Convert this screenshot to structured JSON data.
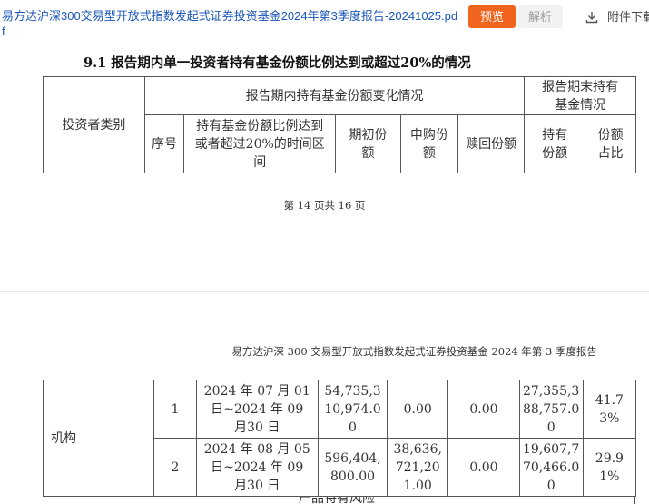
{
  "topbar": {
    "filename": "易方达沪深300交易型开放式指数发起式证券投资基金2024年第3季度报告-20241025.pdf",
    "preview_label": "预览",
    "parse_label": "解析",
    "attachment_label": "附件下载"
  },
  "page1": {
    "section_title": "9.1 报告期内单一投资者持有基金份额比例达到或超过20%的情况",
    "table_headers": {
      "investor_type": "投资者类别",
      "change_group": "报告期内持有基金份额变化情况",
      "end_group": "报告期末持有基金情况",
      "seq": "序号",
      "interval": "持有基金份额比例达到或者超过20%的时间区间",
      "opening": "期初份额",
      "subscribe": "申购份额",
      "redeem": "赎回份额",
      "holding": "持有份额",
      "ratio": "份额占比"
    },
    "footer": "第 14 页共 16 页"
  },
  "page2": {
    "running_header": "易方达沪深 300 交易型开放式指数发起式证券投资基金 2024 年第 3 季度报告",
    "institution_label": "机构",
    "rows": [
      {
        "seq": "1",
        "interval": "2024 年 07 月 01日~2024 年 09 月30 日",
        "opening": "54,735,310,974.00",
        "subscribe": "0.00",
        "redeem": "0.00",
        "holding": "27,355,388,757.00",
        "ratio": "41.73%"
      },
      {
        "seq": "2",
        "interval": "2024 年 08 月 05日~2024 年 09 月30 日",
        "opening": "596,404,800.00",
        "subscribe": "38,636,721,201.00",
        "redeem": "0.00",
        "holding": "19,607,770,466.00",
        "ratio": "29.91%"
      }
    ],
    "cutoff_text": "产品特有风险"
  },
  "colors": {
    "link": "#1a56b8",
    "preview_bg": "#f0641e",
    "parse_bg": "#f2f2f2"
  }
}
